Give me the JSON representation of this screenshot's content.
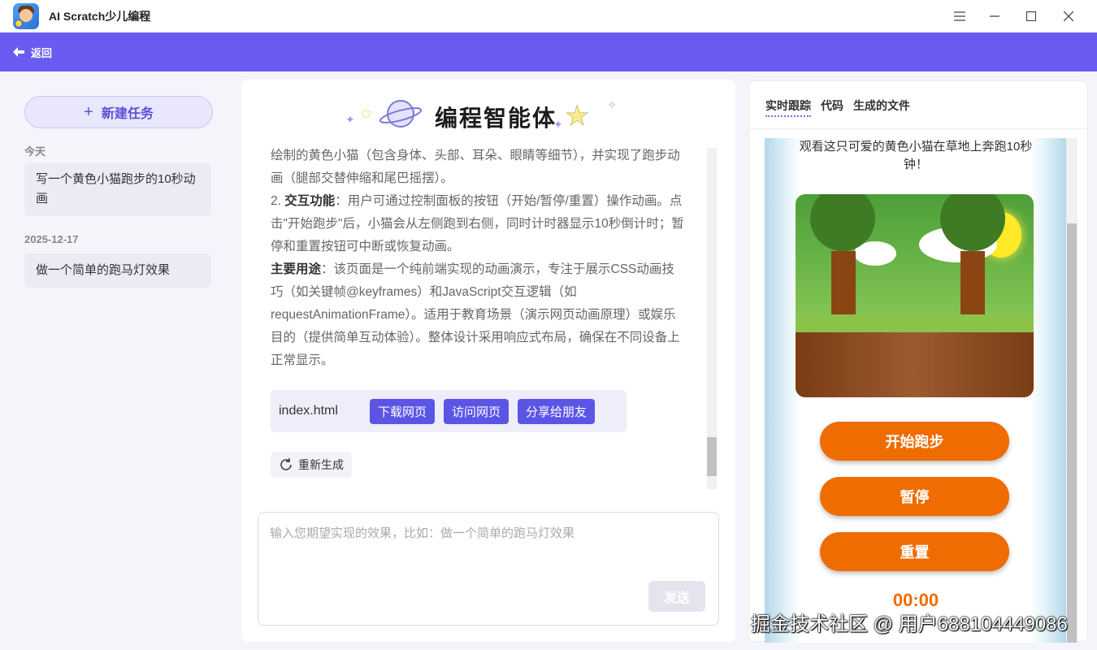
{
  "app": {
    "title": "AI Scratch少儿编程"
  },
  "window_controls": {
    "menu_icon": "menu-icon",
    "minimize_icon": "minimize-icon",
    "maximize_icon": "maximize-icon",
    "close_icon": "close-icon"
  },
  "nav": {
    "back_label": "返回",
    "back_icon": "arrow-left-icon",
    "color": "#6a5cf0"
  },
  "sidebar": {
    "new_task_label": "新建任务",
    "groups": [
      {
        "label": "今天",
        "items": [
          "写一个黄色小猫跑步的10秒动画"
        ]
      },
      {
        "label": "2025-12-17",
        "items": [
          "做一个简单的跑马灯效果"
        ]
      }
    ]
  },
  "main": {
    "hero_title": "编程智能体",
    "paragraphs": [
      {
        "bold": "",
        "text": "绘制的黄色小猫（包含身体、头部、耳朵、眼睛等细节），并实现了跑步动画（腿部交替伸缩和尾巴摇摆）。"
      },
      {
        "prefix": "2. ",
        "bold": "交互功能",
        "text": "：用户可通过控制面板的按钮（开始/暂停/重置）操作动画。点击\"开始跑步\"后，小猫会从左侧跑到右侧，同时计时器显示10秒倒计时；暂停和重置按钮可中断或恢复动画。"
      },
      {
        "prefix": "",
        "bold": "主要用途",
        "text": "：该页面是一个纯前端实现的动画演示，专注于展示CSS动画技巧（如关键帧@keyframes）和JavaScript交互逻辑（如requestAnimationFrame）。适用于教育场景（演示网页动画原理）或娱乐目的（提供简单互动体验）。整体设计采用响应式布局，确保在不同设备上正常显示。"
      }
    ],
    "file": {
      "name": "index.html",
      "download": "下载网页",
      "visit": "访问网页",
      "share": "分享给朋友"
    },
    "regenerate_label": "重新生成",
    "input_placeholder": "输入您期望实现的效果，比如：做一个简单的跑马灯效果",
    "send_label": "发送"
  },
  "right_panel": {
    "tabs": [
      "实时跟踪",
      "代码",
      "生成的文件"
    ],
    "preview": {
      "heading": "观看这只可爱的黄色小猫在草地上奔跑10秒钟！",
      "start": "开始跑步",
      "pause": "暂停",
      "reset": "重置",
      "timer": "00:00",
      "accent": "#ef6c00"
    }
  },
  "watermark": "掘金技术社区 @ 用户688104449086"
}
